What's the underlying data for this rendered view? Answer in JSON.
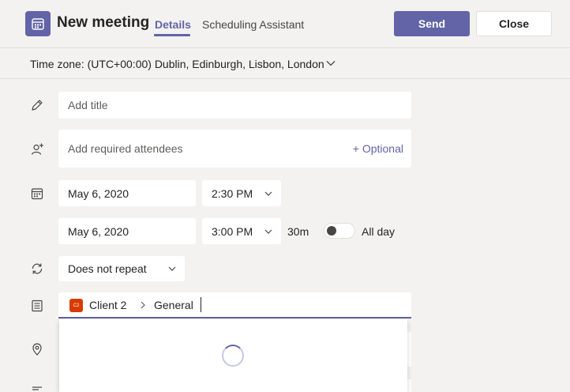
{
  "header": {
    "title": "New meeting",
    "tabs": [
      {
        "label": "Details",
        "active": true
      },
      {
        "label": "Scheduling Assistant",
        "active": false
      }
    ],
    "send_label": "Send",
    "close_label": "Close"
  },
  "timezone": {
    "label": "Time zone: (UTC+00:00) Dublin, Edinburgh, Lisbon, London"
  },
  "form": {
    "title_placeholder": "Add title",
    "attendees_placeholder": "Add required attendees",
    "optional_label": "+ Optional",
    "start_date": "May 6, 2020",
    "start_time": "2:30 PM",
    "end_date": "May 6, 2020",
    "end_time": "3:00 PM",
    "duration": "30m",
    "all_day_label": "All day",
    "repeat": "Does not repeat",
    "channel": {
      "team_badge": "C2",
      "team": "Client 2",
      "channel": "General"
    }
  },
  "colors": {
    "accent": "#6264a7",
    "team_badge": "#d83b01",
    "background": "#f3f2f1"
  },
  "icons": [
    "calendar-icon",
    "pencil-icon",
    "add-person-icon",
    "calendar-small-icon",
    "repeat-icon",
    "channel-icon",
    "location-icon",
    "chevron-down-icon",
    "chevron-right-icon",
    "spinner-icon"
  ]
}
